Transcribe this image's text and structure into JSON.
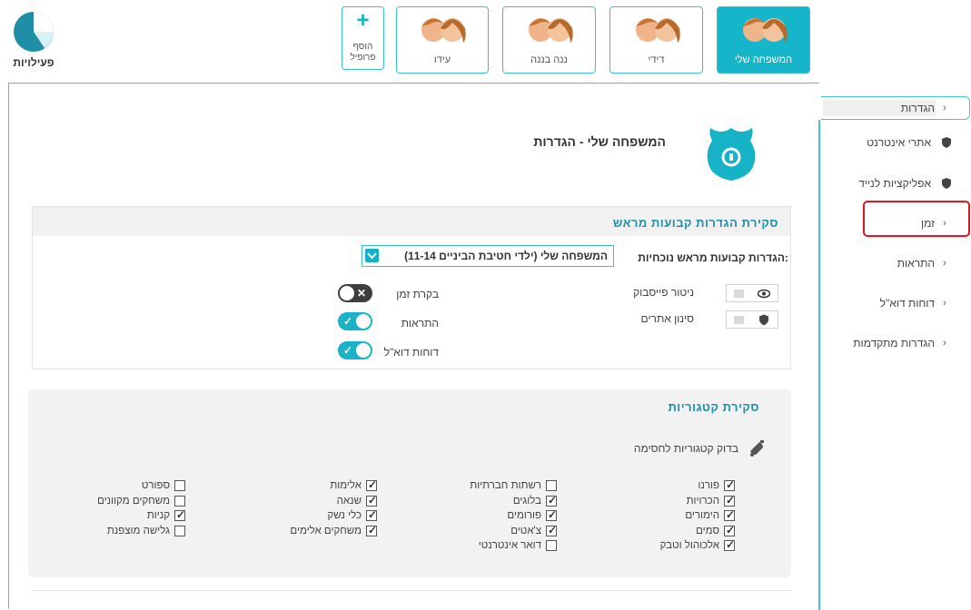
{
  "app": {
    "title": "פעילויות"
  },
  "profiles": [
    {
      "label": "המשפחה שלי",
      "active": true
    },
    {
      "label": "דידי",
      "active": false
    },
    {
      "label": "ננה בננה",
      "active": false
    },
    {
      "label": "עידו",
      "active": false
    }
  ],
  "add_profile": {
    "plus": "+",
    "label_line1": "הוסף",
    "label_line2": "פרופיל"
  },
  "sidebar": {
    "items": [
      {
        "label": "הגדרות",
        "chevron": "›"
      },
      {
        "label": "אתרי אינטרנט",
        "icon": "shield-icon"
      },
      {
        "label": "אפליקציות לנייד",
        "icon": "shield-icon"
      },
      {
        "label": "זמן",
        "chevron": "›"
      },
      {
        "label": "התראות",
        "chevron": "›"
      },
      {
        "label": "דוחות דוא\"ל",
        "chevron": "›"
      },
      {
        "label": "הגדרות מתקדמות",
        "chevron": "›"
      }
    ]
  },
  "page": {
    "title": "המשפחה שלי - הגדרות"
  },
  "preset": {
    "title": "סקירת הגדרות קבועות מראש",
    "current_label": "הגדרות קבועות מראש נוכחיות:",
    "current_value": "המשפחה שלי (ילדי חטיבת הביניים 11-14)"
  },
  "monitors": [
    {
      "label": "ניטור פייסבוק",
      "icon": "eye-icon"
    },
    {
      "label": "סינון אתרים",
      "icon": "shield-icon"
    }
  ],
  "toggles": [
    {
      "label": "בקרת זמן",
      "state": "off",
      "mark": "✕"
    },
    {
      "label": "התראות",
      "state": "on",
      "mark": "✓"
    },
    {
      "label": "דוחות דוא\"ל",
      "state": "on",
      "mark": "✓"
    }
  ],
  "categories": {
    "title": "סקירת קטגוריות",
    "check_label": "בדוק קטגוריות לחסימה",
    "columns": [
      [
        {
          "label": "פורנו",
          "checked": true
        },
        {
          "label": "הכרויות",
          "checked": true
        },
        {
          "label": "הימורים",
          "checked": true
        },
        {
          "label": "סמים",
          "checked": true
        },
        {
          "label": "אלכוהול וטבק",
          "checked": true
        }
      ],
      [
        {
          "label": "רשתות חברתיות",
          "checked": false
        },
        {
          "label": "בלוגים",
          "checked": true
        },
        {
          "label": "פורומים",
          "checked": true
        },
        {
          "label": "צ'אטים",
          "checked": true
        },
        {
          "label": "דואר אינטרנטי",
          "checked": false
        }
      ],
      [
        {
          "label": "אלימות",
          "checked": true
        },
        {
          "label": "שנאה",
          "checked": true
        },
        {
          "label": "כלי נשק",
          "checked": true
        },
        {
          "label": "משחקים אלימים",
          "checked": true
        }
      ],
      [
        {
          "label": "ספורט",
          "checked": false
        },
        {
          "label": "משחקים מקוונים",
          "checked": false
        },
        {
          "label": "קניות",
          "checked": true
        },
        {
          "label": "גלישה מוצפנת",
          "checked": false
        }
      ]
    ]
  },
  "colors": {
    "accent": "#15b6c9",
    "highlight": "#e0151c",
    "heading": "#1f8fa8"
  }
}
